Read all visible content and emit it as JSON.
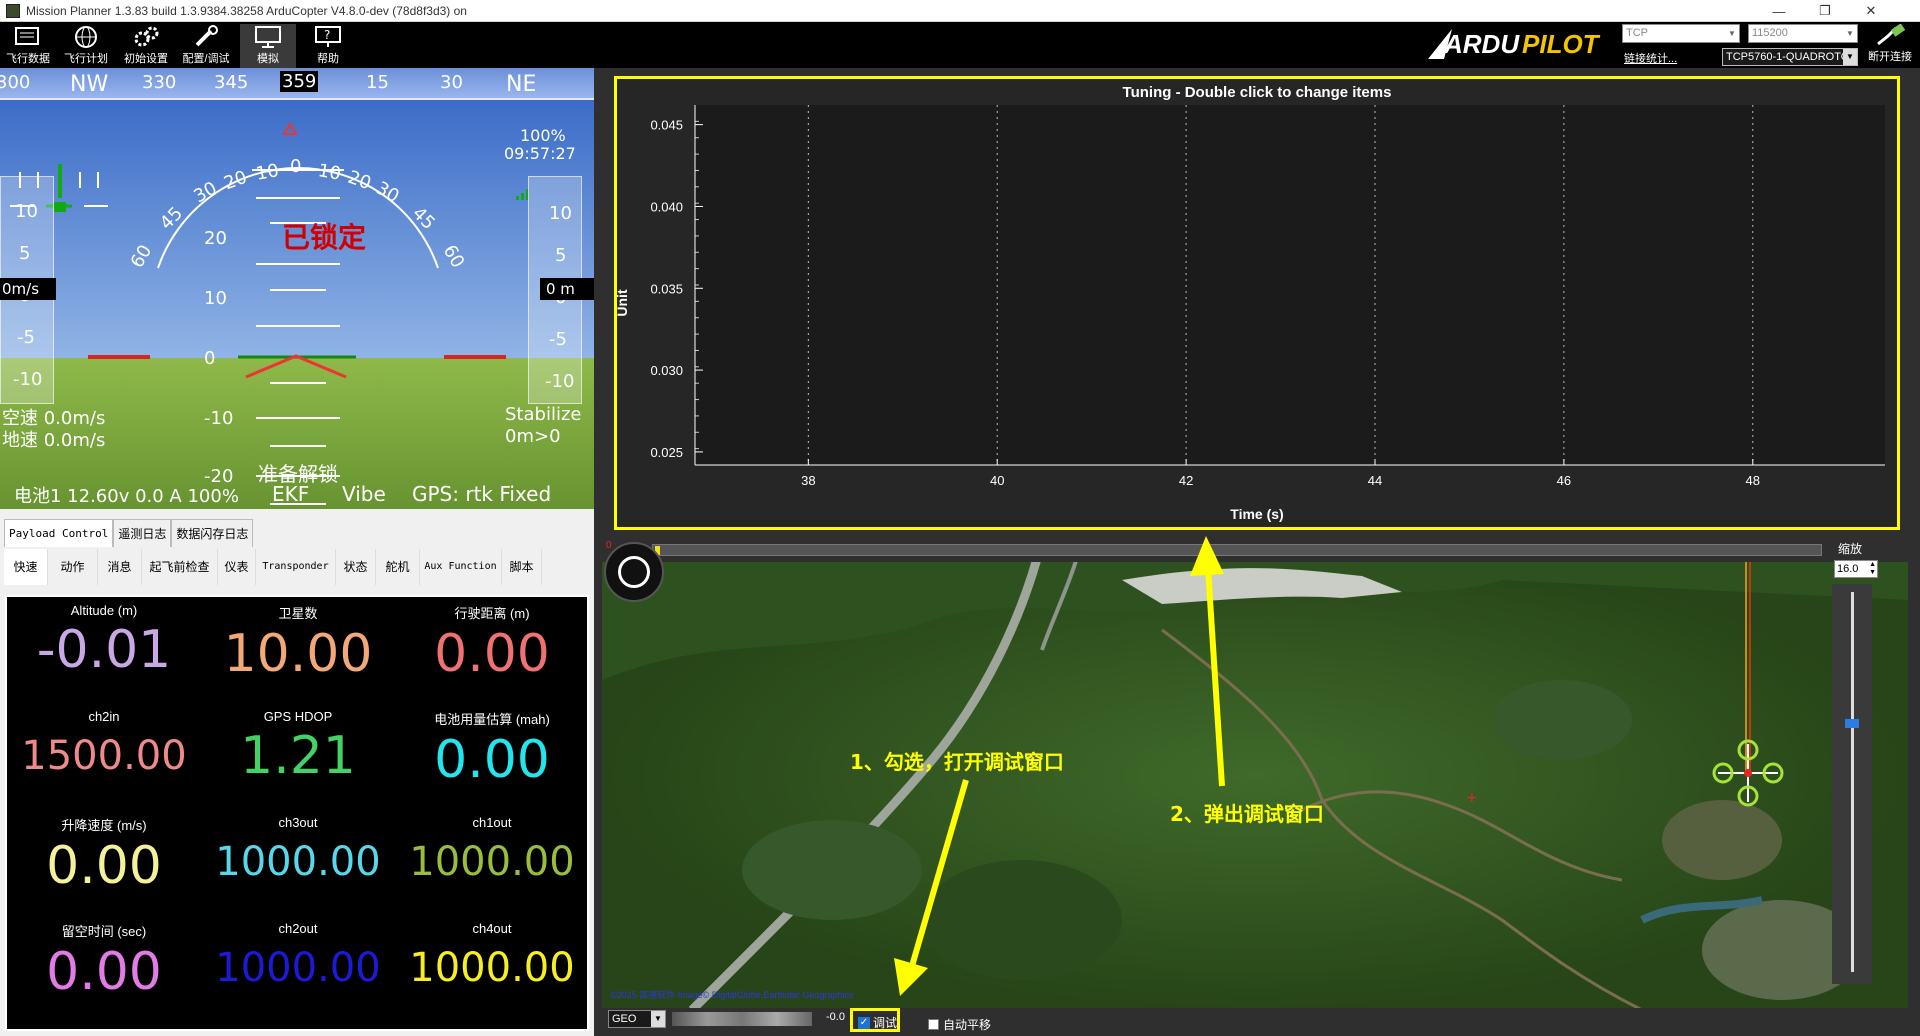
{
  "window": {
    "title": "Mission Planner 1.3.83 build 1.3.9384.38258 ArduCopter V4.8.0-dev (78d8f3d3) on",
    "controls": [
      "—",
      "❐",
      "✕"
    ]
  },
  "toolbar": {
    "buttons": [
      {
        "label": "飞行数据",
        "icon": "flight-data-icon"
      },
      {
        "label": "飞行计划",
        "icon": "globe-icon"
      },
      {
        "label": "初始设置",
        "icon": "gears-icon"
      },
      {
        "label": "配置/调试",
        "icon": "wrench-icon"
      },
      {
        "label": "模拟",
        "icon": "monitor-icon"
      },
      {
        "label": "帮助",
        "icon": "help-icon"
      }
    ],
    "active_index": 4,
    "brand": "ARDUPILOT",
    "connection_type": "TCP",
    "baud_rate": "115200",
    "link_stats": "链接统计...",
    "port": "TCP5760-1-QUADROTO",
    "disconnect_label": "断开连接"
  },
  "hud": {
    "compass": [
      "300",
      "NW",
      "330",
      "345",
      "359",
      "15",
      "30",
      "NE"
    ],
    "locked_text": "已锁定",
    "battery_percent_top": "100%",
    "time": "09:57:27",
    "speed_readout": "0m/s",
    "alt_readout": "0 m",
    "speed_ticks": [
      "10",
      "5",
      "0",
      "-5",
      "-10"
    ],
    "alt_ticks": [
      "10",
      "5",
      "0",
      "-5",
      "-10"
    ],
    "pitch_ticks": [
      "20",
      "10",
      "0",
      "-10",
      "-20"
    ],
    "roll_ticks": [
      "60",
      "45",
      "30",
      "20",
      "10",
      "0",
      "10",
      "20",
      "30",
      "45",
      "60"
    ],
    "airspeed": "空速 0.0m/s",
    "groundspeed": "地速 0.0m/s",
    "mode": "Stabilize",
    "mode_sub": "0m>0",
    "arm_status": "准备解锁",
    "battery": "电池1 12.60v 0.0 A 100%",
    "ekf": "EKF",
    "vibe": "Vibe",
    "gps": "GPS: rtk Fixed"
  },
  "tabs": {
    "row1": [
      "Payload Control",
      "遥测日志",
      "数据闪存日志"
    ],
    "row2": [
      "快速",
      "动作",
      "消息",
      "起飞前检查",
      "仪表",
      "Transponder",
      "状态",
      "舵机",
      "Aux Function",
      "脚本"
    ]
  },
  "quick": [
    {
      "label": "Altitude (m)",
      "value": "-0.01",
      "color": "#c9a8e6"
    },
    {
      "label": "卫星数",
      "value": "10.00",
      "color": "#f2a977"
    },
    {
      "label": "行驶距离 (m)",
      "value": "0.00",
      "color": "#ee7272"
    },
    {
      "label": "ch2in",
      "value": "1500.00",
      "color": "#f08a8a"
    },
    {
      "label": "GPS HDOP",
      "value": "1.21",
      "color": "#44d166"
    },
    {
      "label": "电池用量估算 (mah)",
      "value": "0.00",
      "color": "#22e6ee"
    },
    {
      "label": "升降速度 (m/s)",
      "value": "0.00",
      "color": "#f3f29a"
    },
    {
      "label": "ch3out",
      "value": "1000.00",
      "color": "#59d7ea"
    },
    {
      "label": "ch1out",
      "value": "1000.00",
      "color": "#9bbd3d"
    },
    {
      "label": "留空时间 (sec)",
      "value": "0.00",
      "color": "#e27be6"
    },
    {
      "label": "ch2out",
      "value": "1000.00",
      "color": "#1d1ad6"
    },
    {
      "label": "ch4out",
      "value": "1000.00",
      "color": "#f7ee22"
    }
  ],
  "chart_data": {
    "type": "line",
    "title": "Tuning - Double click to change items",
    "xlabel": "Time (s)",
    "ylabel": "Unit",
    "x_ticks": [
      38,
      40,
      42,
      44,
      46,
      48
    ],
    "y_ticks": [
      0.045,
      0.04,
      0.035,
      0.03,
      0.025
    ],
    "y_tick_labels": [
      "0.045",
      "0.040",
      "0.035",
      "0.030",
      "0.025"
    ],
    "xlim": [
      36.8,
      49.4
    ],
    "ylim": [
      0.0242,
      0.0462
    ],
    "series": [],
    "grid": true
  },
  "map": {
    "zoom_label": "缩放",
    "zoom_value": "16.0",
    "coord_system": "GEO",
    "coord_value": "-0.0",
    "debug_label": "调试",
    "debug_checked": true,
    "auto_pan_label": "自动平移",
    "auto_pan_checked": false,
    "slider_zero": "0",
    "copyright": "©2025 高德软件 Image© DigitalGlobe,Earthstar Geographics"
  },
  "annotations": {
    "step1": "1、勾选，打开调试窗口",
    "step2": "2、弹出调试窗口",
    "color": "#ffff00"
  }
}
